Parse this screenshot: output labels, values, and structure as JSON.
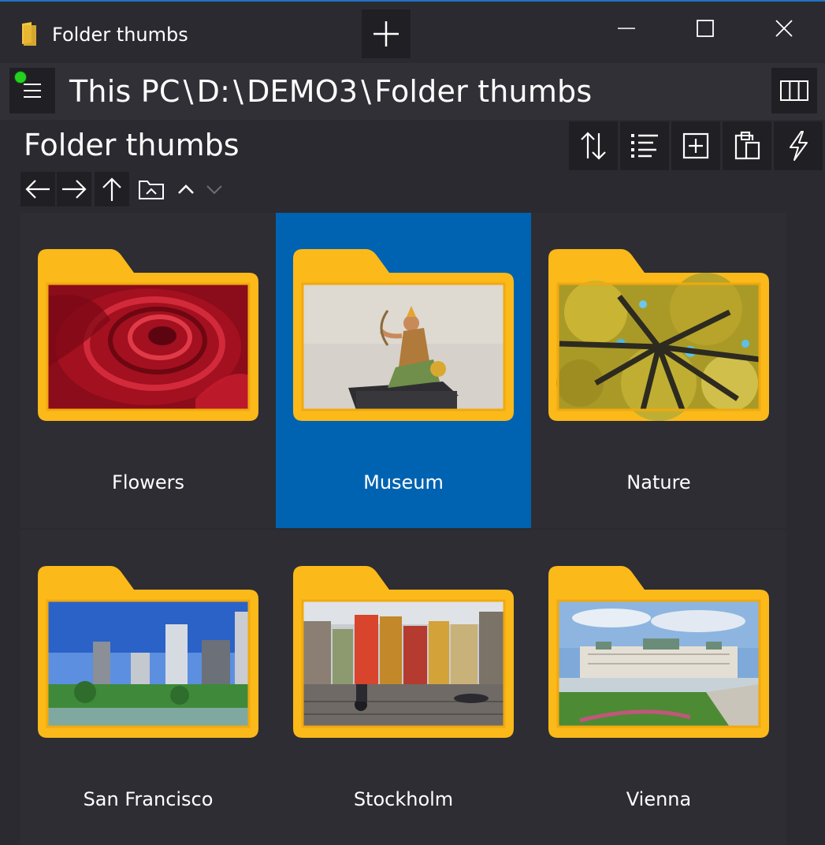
{
  "window": {
    "title": "Folder thumbs",
    "new_tab_icon": "plus-icon",
    "minimize_icon": "minimize-icon",
    "maximize_icon": "maximize-icon",
    "close_icon": "close-icon"
  },
  "address": {
    "segments": [
      "This PC",
      "D:",
      "DEMO3",
      "Folder thumbs"
    ],
    "separator": "\\"
  },
  "header": {
    "title": "Folder thumbs"
  },
  "colors": {
    "background": "#2b2a30",
    "selection": "#0063b1",
    "folder": "#fbb91a",
    "status_dot": "#25d021"
  },
  "folders": [
    {
      "name": "Flowers",
      "selected": false
    },
    {
      "name": "Museum",
      "selected": true
    },
    {
      "name": "Nature",
      "selected": false
    },
    {
      "name": "San Francisco",
      "selected": false
    },
    {
      "name": "Stockholm",
      "selected": false
    },
    {
      "name": "Vienna",
      "selected": false
    }
  ]
}
